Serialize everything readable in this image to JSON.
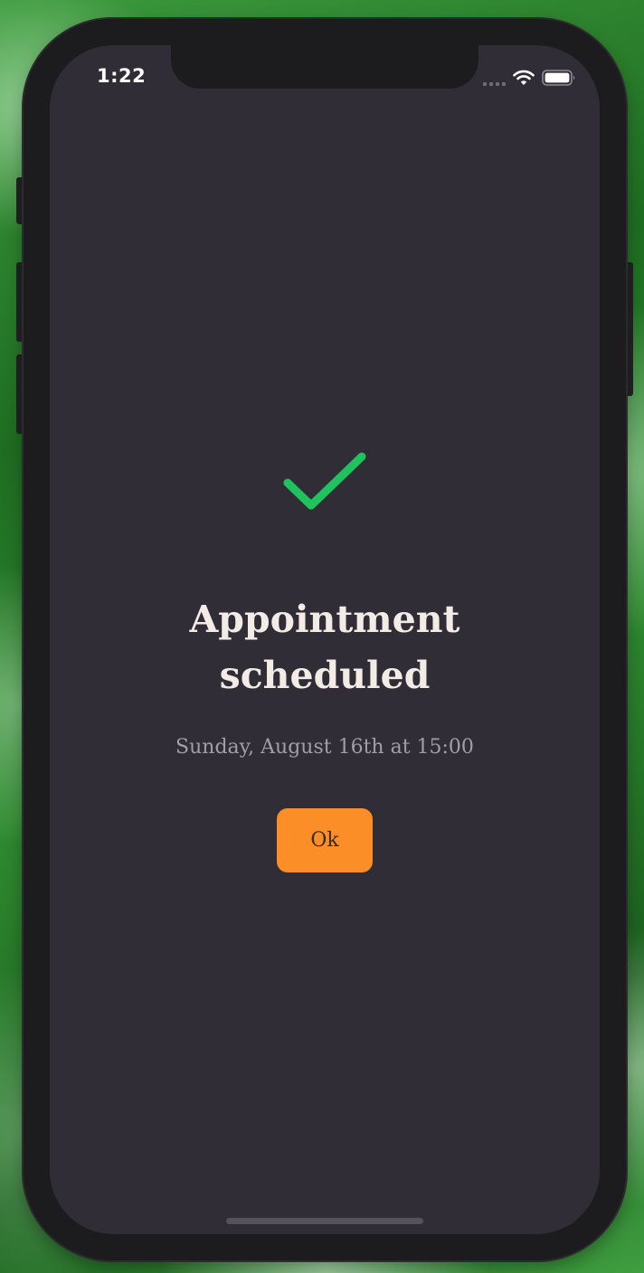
{
  "status_bar": {
    "time": "1:22",
    "signal_icon": "cellular-signal-icon",
    "wifi_icon": "wifi-icon",
    "battery_icon": "battery-icon"
  },
  "confirmation": {
    "icon": "checkmark-icon",
    "icon_color": "#1fc35e",
    "title_line1": "Appointment",
    "title_line2": "scheduled",
    "subtitle": "Sunday, August 16th at 15:00",
    "ok_label": "Ok",
    "ok_color": "#fb8e27"
  }
}
